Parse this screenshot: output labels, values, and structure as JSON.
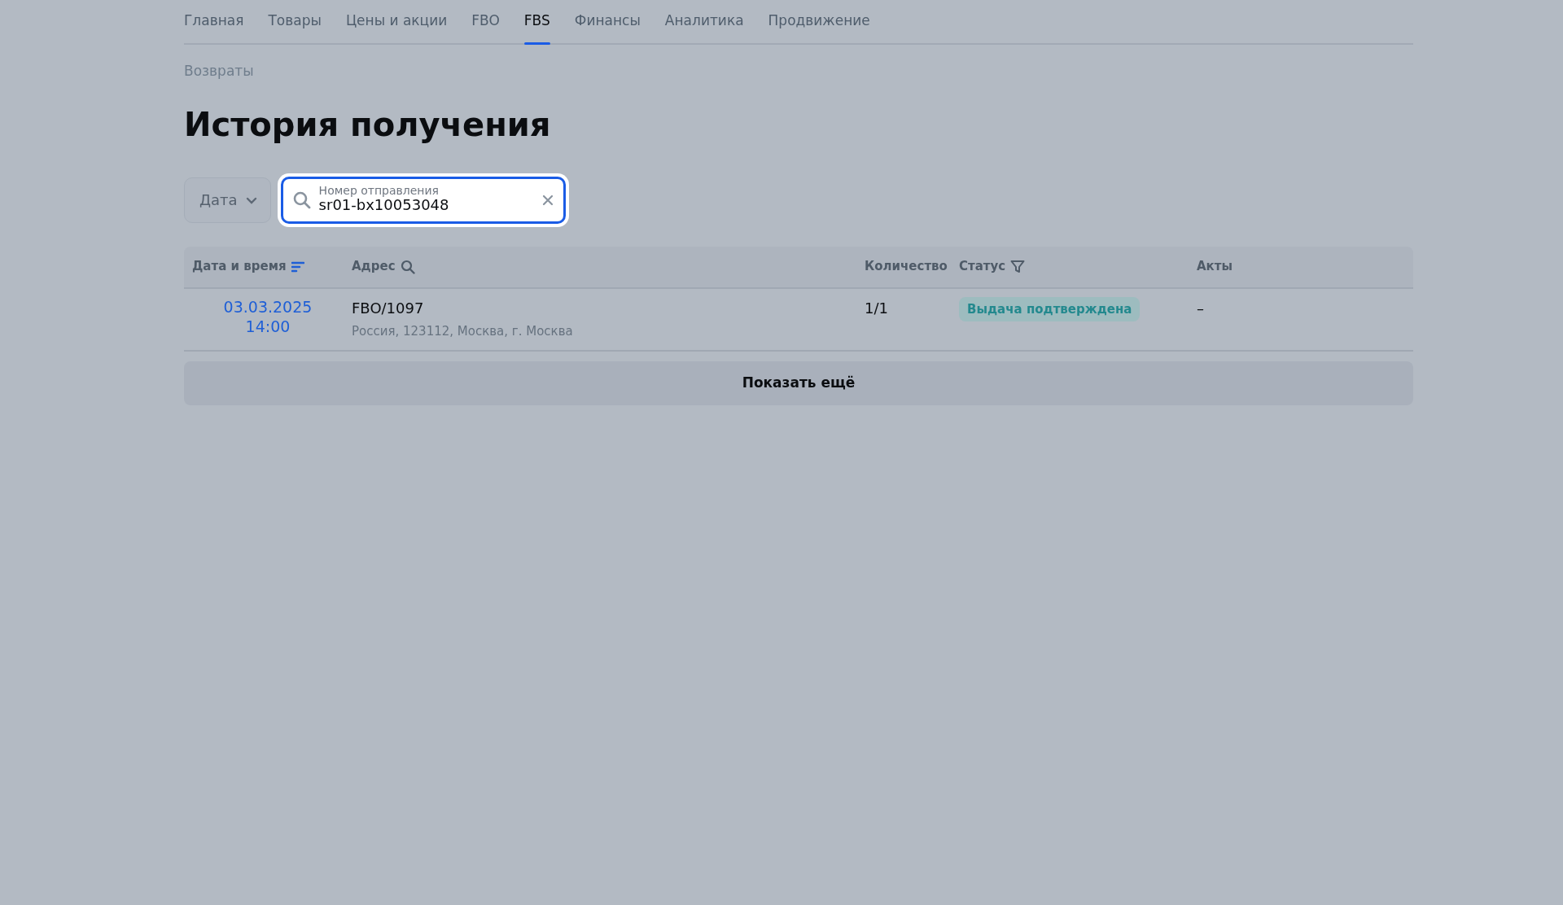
{
  "nav": {
    "tabs": [
      {
        "label": "Главная",
        "selected": false
      },
      {
        "label": "Товары",
        "selected": false
      },
      {
        "label": "Цены и акции",
        "selected": false
      },
      {
        "label": "FBO",
        "selected": false
      },
      {
        "label": "FBS",
        "selected": true
      },
      {
        "label": "Финансы",
        "selected": false
      },
      {
        "label": "Аналитика",
        "selected": false
      },
      {
        "label": "Продвижение",
        "selected": false
      }
    ]
  },
  "breadcrumb": "Возвраты",
  "title": "История получения",
  "filters": {
    "date_button": "Дата",
    "search": {
      "label": "Номер отправления",
      "value": "sr01-bx10053048",
      "focused": true
    }
  },
  "table": {
    "columns": [
      {
        "label": "Дата и время",
        "kind": "sort"
      },
      {
        "label": "Адрес",
        "kind": "search"
      },
      {
        "label": "Количество"
      },
      {
        "label": "Статус",
        "kind": "filter"
      },
      {
        "label": "Акты"
      }
    ],
    "rows": [
      {
        "date": "03.03.2025",
        "time": "14:00",
        "address": "FBO/1097",
        "address_detail": "Россия, 123112, Москва, г. Москва",
        "quantity": "1/1",
        "status": "Выдача подтверждена",
        "acts": "–"
      }
    ]
  },
  "show_more": "Показать ещё"
}
